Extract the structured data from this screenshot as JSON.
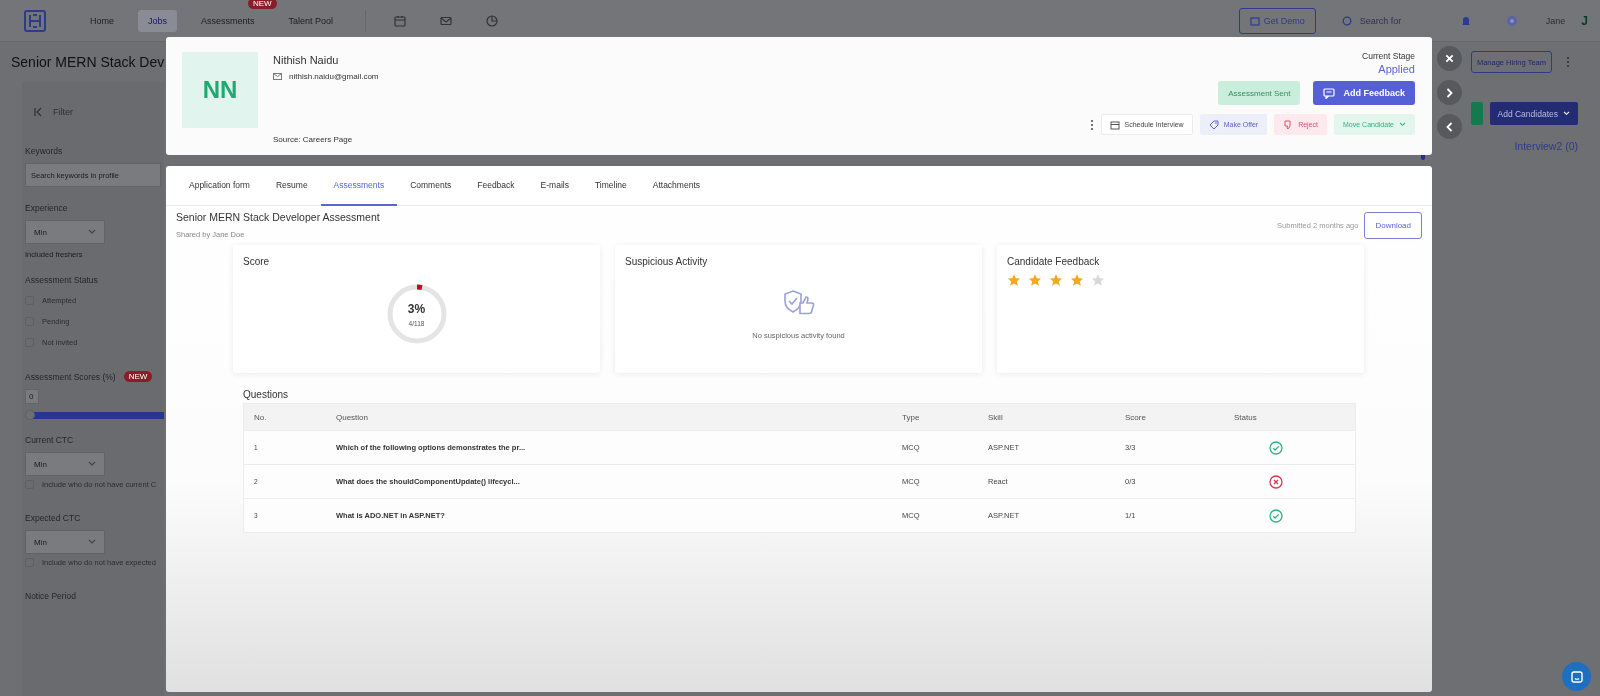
{
  "nav": {
    "links": [
      {
        "label": "Home",
        "selected": false
      },
      {
        "label": "Jobs",
        "selected": true
      },
      {
        "label": "Assessments",
        "selected": false,
        "badge": "NEW"
      },
      {
        "label": "Talent Pool",
        "selected": false
      }
    ],
    "demo_button": "Get Demo",
    "search_placeholder": "Search for",
    "user_name": "Jane",
    "avatar": "J"
  },
  "job": {
    "title": "Senior MERN Stack Dev",
    "manage_button": "Manage Hiring Team",
    "add_button": "Add Candidates",
    "stage": "Interview2 (0)"
  },
  "filters": {
    "header": "Filter",
    "items": [
      {
        "kind": "heading",
        "label": "Keywords"
      },
      {
        "kind": "input",
        "placeholder": "Search keywords in profile"
      },
      {
        "kind": "heading",
        "label": "Experience"
      },
      {
        "kind": "select",
        "value": "Min"
      },
      {
        "kind": "note",
        "label": "Included freshers"
      },
      {
        "kind": "heading",
        "label": "Assessment Status"
      },
      {
        "kind": "checkbox",
        "label": "Attempted",
        "checked": false
      },
      {
        "kind": "checkbox",
        "label": "Pending",
        "checked": false
      },
      {
        "kind": "checkbox",
        "label": "Not invited",
        "checked": false
      },
      {
        "kind": "heading",
        "label": "Assessment Scores (%)",
        "badge": "NEW"
      },
      {
        "kind": "range",
        "value": "0",
        "level": 1
      },
      {
        "kind": "heading",
        "label": "Current CTC"
      },
      {
        "kind": "select",
        "value": "Min"
      },
      {
        "kind": "checkbox",
        "label": "Include who do not have current C",
        "checked": false
      },
      {
        "kind": "heading",
        "label": "Expected CTC"
      },
      {
        "kind": "select",
        "value": "Min"
      },
      {
        "kind": "checkbox",
        "label": "Include who do not have expected",
        "checked": false
      },
      {
        "kind": "heading",
        "label": "Notice Period"
      }
    ]
  },
  "candidate": {
    "initials": "NN",
    "name": "Nithish Naidu",
    "email": "nithish.naidu@gmail.com",
    "source": "Source: Careers Page",
    "stage_label": "Current Stage",
    "stage": "Applied",
    "actions": [
      {
        "label": "Assessment Sent",
        "disabled": true
      },
      {
        "label": "Add Feedback",
        "disabled": false
      }
    ],
    "secondary_actions": [
      {
        "kind": "schedule",
        "label": "Schedule Interview"
      },
      {
        "kind": "offer",
        "label": "Make Offer"
      },
      {
        "kind": "reject",
        "label": "Reject"
      },
      {
        "kind": "move",
        "label": "Move Candidate"
      }
    ]
  },
  "tabs": [
    {
      "label": "Application form",
      "selected": false
    },
    {
      "label": "Resume",
      "selected": false
    },
    {
      "label": "Assessments",
      "selected": true
    },
    {
      "label": "Comments",
      "selected": false
    },
    {
      "label": "Feedback",
      "selected": false
    },
    {
      "label": "E-mails",
      "selected": false
    },
    {
      "label": "Timeline",
      "selected": false
    },
    {
      "label": "Attachments",
      "selected": false
    }
  ],
  "assessment": {
    "title": "Senior MERN Stack Developer Assessment",
    "shared_by": "Shared by Jane Doe",
    "submitted": "Submitted 2 months ago",
    "download": "Download"
  },
  "score": {
    "title": "Score",
    "percent": "3%",
    "points": "4/118",
    "level": 0.03
  },
  "suspicious": {
    "title": "Suspicious Activity",
    "message": "No suspicious activity found"
  },
  "feedback": {
    "title": "Candidate Feedback",
    "stars": 4
  },
  "questions": {
    "title": "Questions",
    "columns": [
      "No.",
      "Question",
      "Type",
      "Skill",
      "Score",
      "Status"
    ],
    "rows": [
      {
        "no": "1",
        "question": "Which of the following options demonstrates the pr...",
        "type": "MCQ",
        "skill": "ASP.NET",
        "score": "3/3",
        "kind": "correct"
      },
      {
        "no": "2",
        "question": "What does the shouldComponentUpdate() lifecycl...",
        "type": "MCQ",
        "skill": "React",
        "score": "0/3",
        "kind": "wrong"
      },
      {
        "no": "3",
        "question": "What is ADO.NET in ASP.NET?",
        "type": "MCQ",
        "skill": "ASP.NET",
        "score": "1/1",
        "kind": "correct"
      }
    ]
  }
}
